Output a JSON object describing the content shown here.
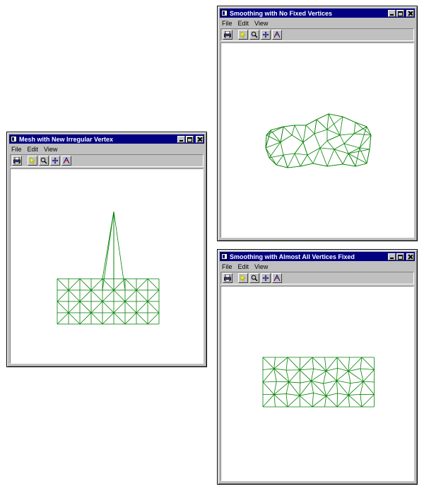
{
  "mesh_color": "#008000",
  "windows": [
    {
      "id": "irregular",
      "title": "Mesh with New Irregular Vertex",
      "menu": [
        "File",
        "Edit",
        "View"
      ],
      "toolbar_icons": [
        "print-icon",
        "select-icon",
        "zoom-icon",
        "pan-icon",
        "rotate-icon"
      ]
    },
    {
      "id": "no-fixed",
      "title": "Smoothing with No Fixed Vertices",
      "menu": [
        "File",
        "Edit",
        "View"
      ],
      "toolbar_icons": [
        "print-icon",
        "select-icon",
        "zoom-icon",
        "pan-icon",
        "rotate-icon"
      ]
    },
    {
      "id": "almost-all-fixed",
      "title": "Smoothing with Almost All Vertices Fixed",
      "menu": [
        "File",
        "Edit",
        "View"
      ],
      "toolbar_icons": [
        "print-icon",
        "select-icon",
        "zoom-icon",
        "pan-icon",
        "rotate-icon"
      ]
    }
  ]
}
